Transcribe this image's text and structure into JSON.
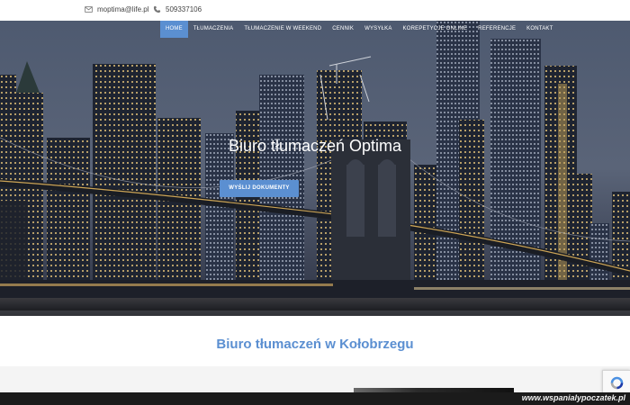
{
  "topbar": {
    "email": "moptima@life.pl",
    "phone": "509337106",
    "email_icon": "envelope-icon",
    "phone_icon": "phone-icon"
  },
  "nav": {
    "items": [
      {
        "label": "HOME",
        "active": true
      },
      {
        "label": "TŁUMACZENIA",
        "active": false
      },
      {
        "label": "TŁUMACZENIE W WEEKEND",
        "active": false
      },
      {
        "label": "CENNIK",
        "active": false
      },
      {
        "label": "WYSYŁKA",
        "active": false
      },
      {
        "label": "KOREPETYCJE ONLINE",
        "active": false
      },
      {
        "label": "REFERENCJE",
        "active": false
      },
      {
        "label": "KONTAKT",
        "active": false
      }
    ]
  },
  "hero": {
    "title": "Biuro tłumaczeń Optima",
    "button_label": "WYŚLIJ DOKUMENTY",
    "background": "night-city-skyline-bridge"
  },
  "section": {
    "title": "Biuro tłumaczeń w Kołobrzegu"
  },
  "recaptcha_icon": "recaptcha-icon",
  "watermark": {
    "text": "www.wspanialypoczatek.pl"
  },
  "colors": {
    "accent": "#5b8fd1",
    "text_dark": "#444444",
    "watermark_bg": "#1b1b1b"
  }
}
